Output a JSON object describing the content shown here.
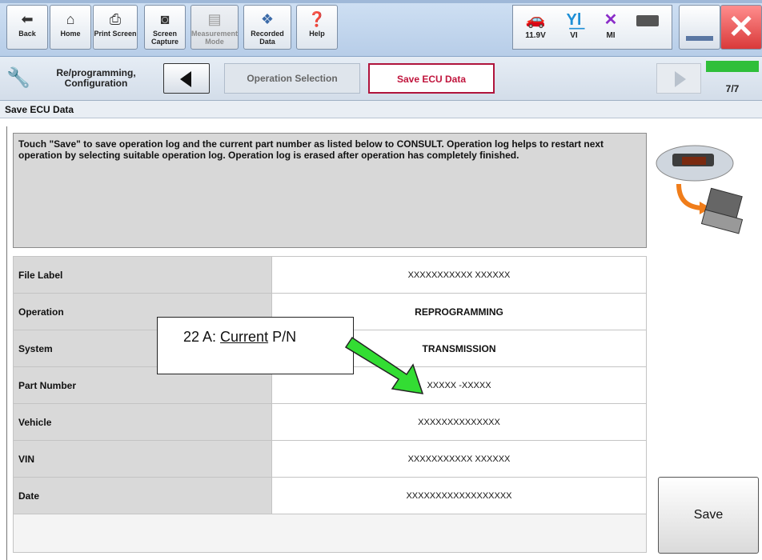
{
  "toolbar": {
    "buttons": [
      {
        "label": "Back",
        "icon": "back-arrow-icon"
      },
      {
        "label": "Home",
        "icon": "home-icon"
      },
      {
        "label": "Print Screen",
        "icon": "printer-icon"
      },
      {
        "label": "Screen Capture",
        "icon": "camera-icon"
      },
      {
        "label": "Measurement Mode",
        "icon": "measurement-icon"
      },
      {
        "label": "Recorded Data",
        "icon": "recorded-data-icon"
      },
      {
        "label": "Help",
        "icon": "help-icon"
      }
    ],
    "status": {
      "voltage": "11.9V",
      "vi": "VI",
      "mi": "MI"
    }
  },
  "breadcrumb": {
    "section": "Re/programming, Configuration",
    "step_prev": "Operation Selection",
    "step_current": "Save ECU Data",
    "progress": "7/7",
    "progress_fraction": 1.0
  },
  "page_title": "Save ECU Data",
  "info_text": "Touch \"Save\" to save operation log and the current part number as listed below to CONSULT. Operation log helps to restart next operation by selecting suitable operation log. Operation log is erased after operation has completely finished.",
  "table": {
    "rows": [
      {
        "key": "File Label",
        "value": "XXXXXXXXXXX XXXXXX"
      },
      {
        "key": "Operation",
        "value": "REPROGRAMMING"
      },
      {
        "key": "System",
        "value": "TRANSMISSION"
      },
      {
        "key": "Part Number",
        "value": "XXXXX -XXXXX"
      },
      {
        "key": "Vehicle",
        "value": "XXXXXXXXXXXXXX"
      },
      {
        "key": "VIN",
        "value": "XXXXXXXXXXX XXXXXX"
      },
      {
        "key": "Date",
        "value": "XXXXXXXXXXXXXXXXXX"
      }
    ]
  },
  "save_label": "Save",
  "callout": {
    "prefix": "22 A: ",
    "underlined": "Current",
    "suffix": " P/N"
  },
  "colors": {
    "accent_red": "#b0143c",
    "progress_green": "#2fbf3a",
    "arrow_green": "#33dd33"
  }
}
